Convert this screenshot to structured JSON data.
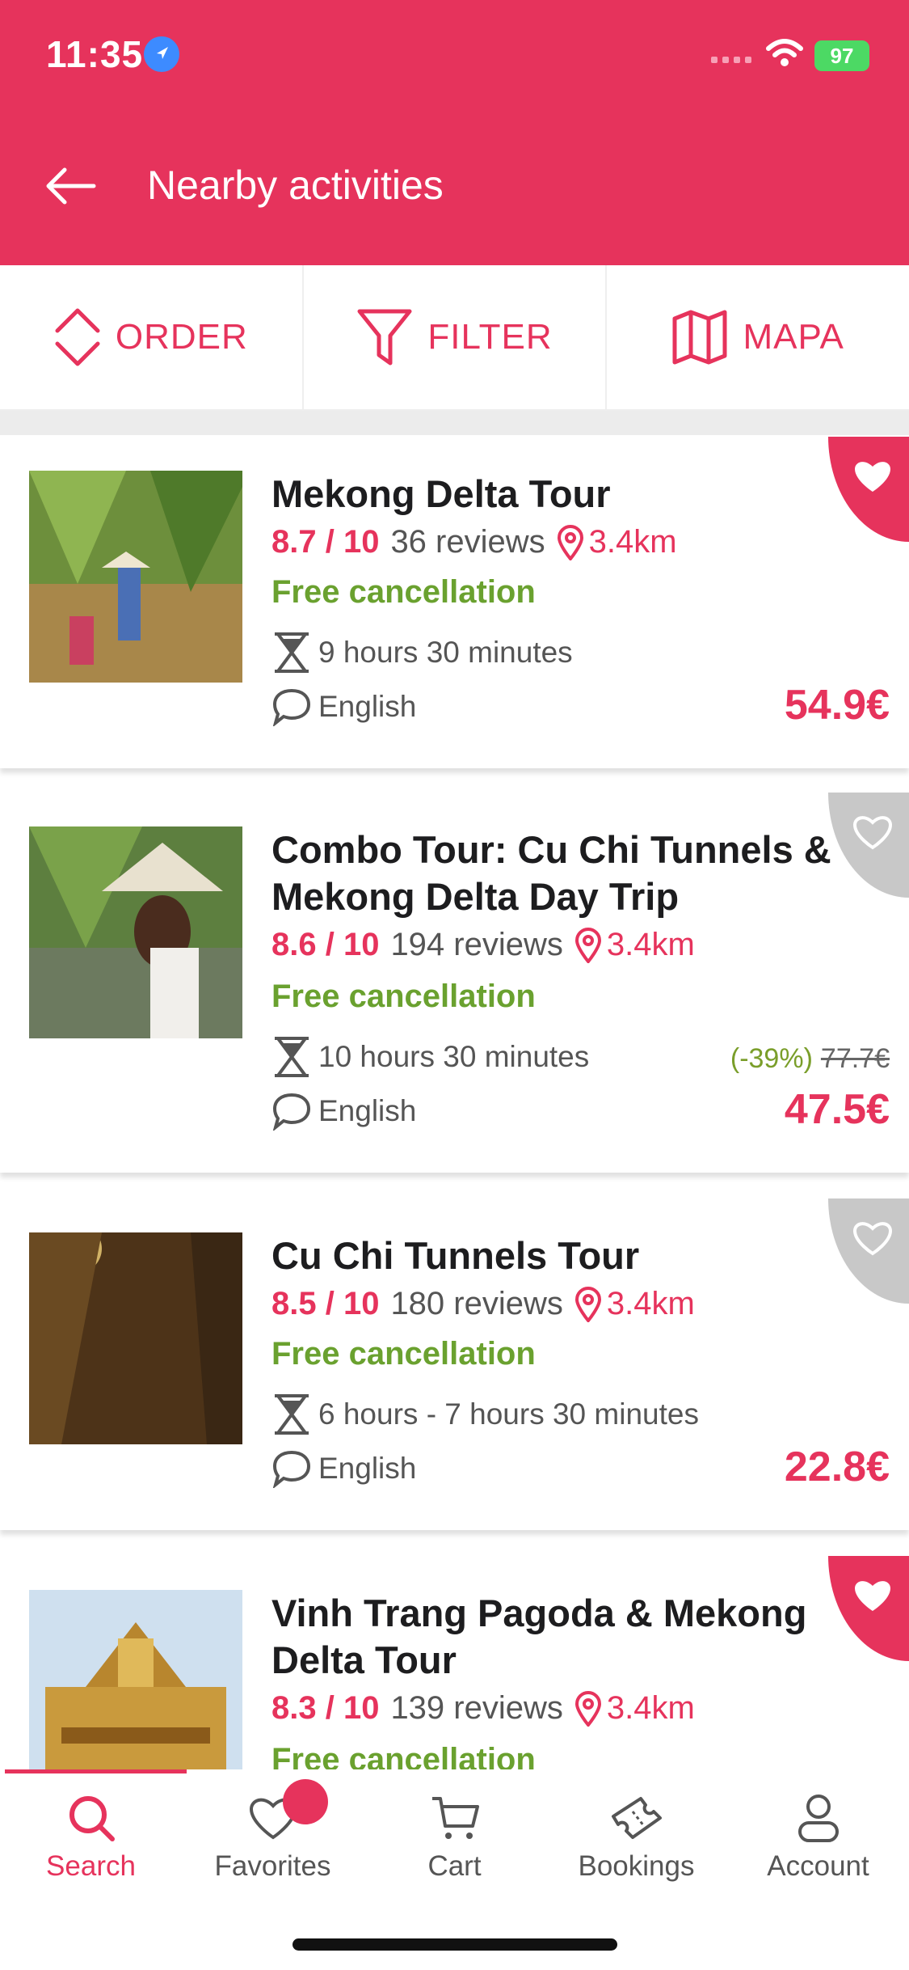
{
  "status_bar": {
    "time": "11:35",
    "battery": "97"
  },
  "header": {
    "title": "Nearby activities"
  },
  "toolbar": {
    "order": "ORDER",
    "filter": "FILTER",
    "map": "MAPA"
  },
  "colors": {
    "accent": "#e6335c",
    "green": "#6aa12f",
    "discount_green": "#7a9e2a"
  },
  "activities": [
    {
      "title": "Mekong Delta Tour",
      "rating": "8.7 / 10",
      "reviews": "36 reviews",
      "distance": "3.4km",
      "cancellation": "Free cancellation",
      "duration": "9 hours 30 minutes",
      "language": "English",
      "price": "54.9€",
      "favorite": true
    },
    {
      "title": "Combo Tour: Cu Chi Tunnels & Mekong Delta Day Trip",
      "rating": "8.6 / 10",
      "reviews": "194 reviews",
      "distance": "3.4km",
      "cancellation": "Free cancellation",
      "duration": "10 hours 30 minutes",
      "language": "English",
      "discount": "(-39%)",
      "old_price": "77.7€",
      "price": "47.5€",
      "favorite": false
    },
    {
      "title": "Cu Chi Tunnels Tour",
      "rating": "8.5 / 10",
      "reviews": "180 reviews",
      "distance": "3.4km",
      "cancellation": "Free cancellation",
      "duration": "6 hours -  7 hours 30 minutes",
      "language": "English",
      "price": "22.8€",
      "favorite": false
    },
    {
      "title": "Vinh Trang Pagoda & Mekong Delta Tour",
      "rating": "8.3 / 10",
      "reviews": "139 reviews",
      "distance": "3.4km",
      "cancellation": "Free cancellation",
      "favorite": true
    }
  ],
  "tabs": [
    {
      "label": "Search",
      "icon": "search-icon",
      "active": true
    },
    {
      "label": "Favorites",
      "icon": "heart-icon"
    },
    {
      "label": "Cart",
      "icon": "cart-icon"
    },
    {
      "label": "Bookings",
      "icon": "ticket-icon"
    },
    {
      "label": "Account",
      "icon": "user-icon"
    }
  ]
}
